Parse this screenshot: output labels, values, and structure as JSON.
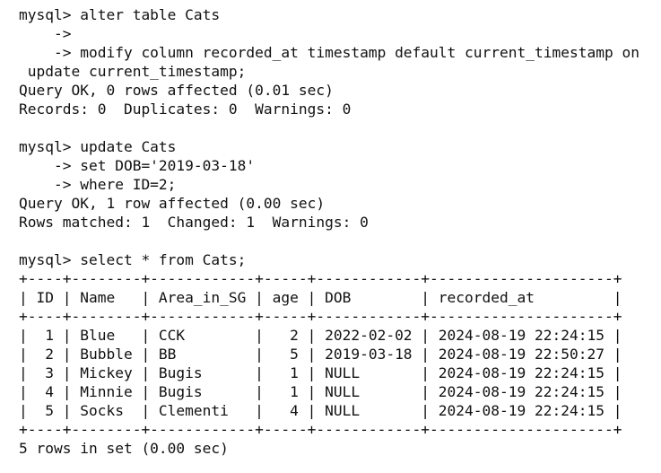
{
  "terminal": {
    "lines": [
      "mysql> alter table Cats",
      "    ->",
      "    -> modify column recorded_at timestamp default current_timestamp on",
      " update current_timestamp;",
      "Query OK, 0 rows affected (0.01 sec)",
      "Records: 0  Duplicates: 0  Warnings: 0",
      "",
      "mysql> update Cats",
      "    -> set DOB='2019-03-18'",
      "    -> where ID=2;",
      "Query OK, 1 row affected (0.00 sec)",
      "Rows matched: 1  Changed: 1  Warnings: 0",
      "",
      "mysql> select * from Cats;",
      "+----+--------+------------+-----+------------+---------------------+",
      "| ID | Name   | Area_in_SG | age | DOB        | recorded_at         |",
      "+----+--------+------------+-----+------------+---------------------+",
      "|  1 | Blue   | CCK        |   2 | 2022-02-02 | 2024-08-19 22:24:15 |",
      "|  2 | Bubble | BB         |   5 | 2019-03-18 | 2024-08-19 22:50:27 |",
      "|  3 | Mickey | Bugis      |   1 | NULL       | 2024-08-19 22:24:15 |",
      "|  4 | Minnie | Bugis      |   1 | NULL       | 2024-08-19 22:24:15 |",
      "|  5 | Socks  | Clementi   |   4 | NULL       | 2024-08-19 22:24:15 |",
      "+----+--------+------------+-----+------------+---------------------+",
      "5 rows in set (0.00 sec)"
    ]
  }
}
